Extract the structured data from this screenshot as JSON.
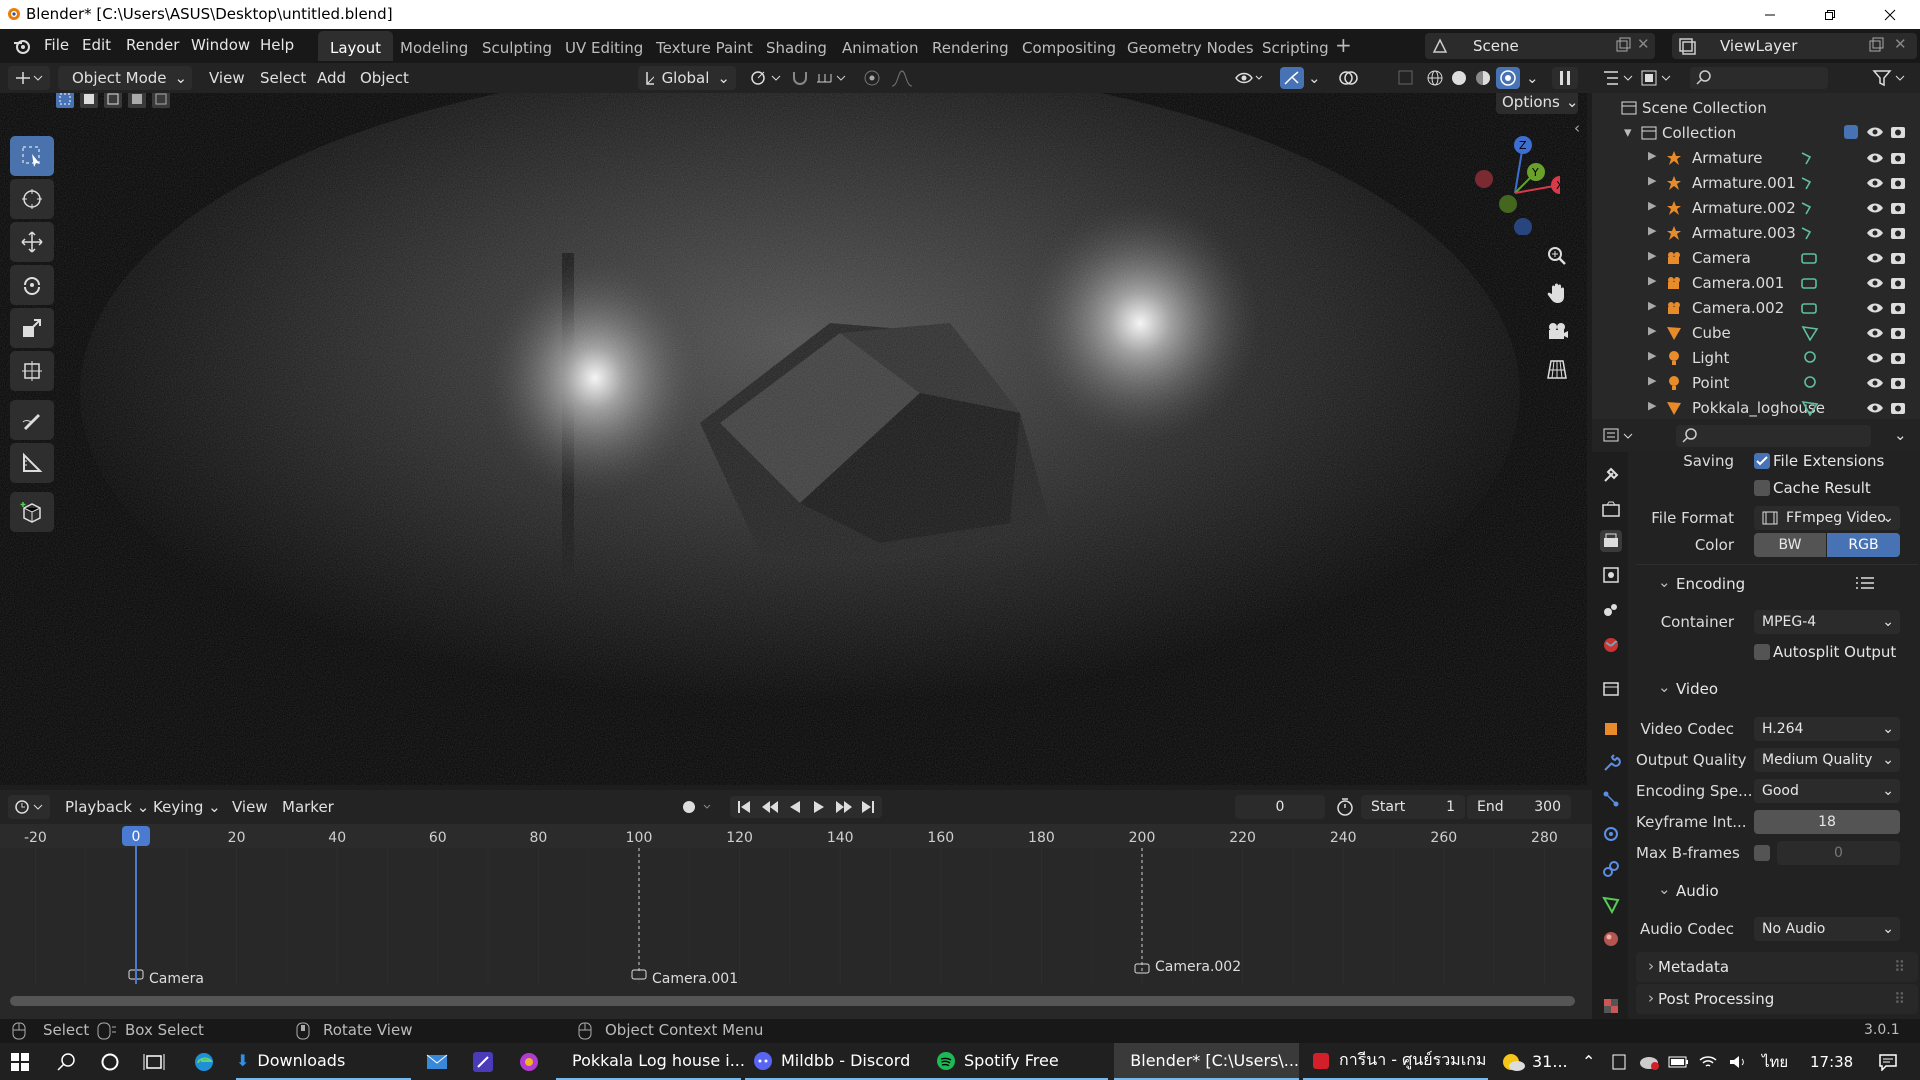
{
  "window": {
    "title": "Blender* [C:\\Users\\ASUS\\Desktop\\untitled.blend]"
  },
  "menu": [
    "File",
    "Edit",
    "Render",
    "Window",
    "Help"
  ],
  "workspaces": [
    "Layout",
    "Modeling",
    "Sculpting",
    "UV Editing",
    "Texture Paint",
    "Shading",
    "Animation",
    "Rendering",
    "Compositing",
    "Geometry Nodes",
    "Scripting"
  ],
  "scene": {
    "name": "Scene",
    "view_layer": "ViewLayer"
  },
  "viewport_header": {
    "mode": "Object Mode",
    "view": "View",
    "select": "Select",
    "add": "Add",
    "object": "Object",
    "orientation": "Global",
    "options": "Options"
  },
  "outliner": {
    "root": "Scene Collection",
    "collection": "Collection",
    "items": [
      {
        "name": "Armature",
        "type": "armature"
      },
      {
        "name": "Armature.001",
        "type": "armature"
      },
      {
        "name": "Armature.002",
        "type": "armature"
      },
      {
        "name": "Armature.003",
        "type": "armature"
      },
      {
        "name": "Camera",
        "type": "camera"
      },
      {
        "name": "Camera.001",
        "type": "camera"
      },
      {
        "name": "Camera.002",
        "type": "camera"
      },
      {
        "name": "Cube",
        "type": "mesh"
      },
      {
        "name": "Light",
        "type": "light"
      },
      {
        "name": "Point",
        "type": "light"
      },
      {
        "name": "Pokkala_loghouse",
        "type": "mesh"
      }
    ]
  },
  "properties": {
    "saving_label": "Saving",
    "file_extensions": "File Extensions",
    "cache_result": "Cache Result",
    "file_format_label": "File Format",
    "file_format": "FFmpeg Video",
    "color_label": "Color",
    "color_bw": "BW",
    "color_rgb": "RGB",
    "encoding": "Encoding",
    "container_label": "Container",
    "container": "MPEG-4",
    "autosplit": "Autosplit Output",
    "video": "Video",
    "video_codec_label": "Video Codec",
    "video_codec": "H.264",
    "output_quality_label": "Output Quality",
    "output_quality": "Medium Quality",
    "encoding_speed_label": "Encoding Spe...",
    "encoding_speed": "Good",
    "keyframe_label": "Keyframe Int...",
    "keyframe": "18",
    "max_bframes_label": "Max B-frames",
    "max_bframes": "0",
    "audio": "Audio",
    "audio_codec_label": "Audio Codec",
    "audio_codec": "No Audio",
    "metadata": "Metadata",
    "post_processing": "Post Processing"
  },
  "timeline": {
    "playback": "Playback",
    "keying": "Keying",
    "view": "View",
    "marker": "Marker",
    "current_frame": "0",
    "start_label": "Start",
    "start": "1",
    "end_label": "End",
    "end": "300",
    "ruler": [
      "-20",
      "0",
      "20",
      "40",
      "60",
      "80",
      "100",
      "120",
      "140",
      "160",
      "180",
      "200",
      "220",
      "240",
      "260",
      "280"
    ],
    "markers": [
      {
        "label": "Camera",
        "frame": 0
      },
      {
        "label": "Camera.001",
        "frame": 100
      },
      {
        "label": "Camera.002",
        "frame": 200
      }
    ]
  },
  "status": {
    "select": "Select",
    "box_select": "Box Select",
    "rotate_view": "Rotate View",
    "context_menu": "Object Context Menu",
    "version": "3.0.1"
  },
  "taskbar": {
    "items": [
      "Downloads",
      "Pokkala Log house i...",
      "Mildbb - Discord",
      "Spotify Free",
      "Blender* [C:\\Users\\...",
      "การีนา - ศูนย์รวมเกม"
    ],
    "weather": "31...",
    "lang": "ไทย",
    "time": "17:38"
  },
  "colors": {
    "accent": "#4772b3",
    "active_tool": "#4a73ad",
    "playhead": "#4b7bd1"
  }
}
